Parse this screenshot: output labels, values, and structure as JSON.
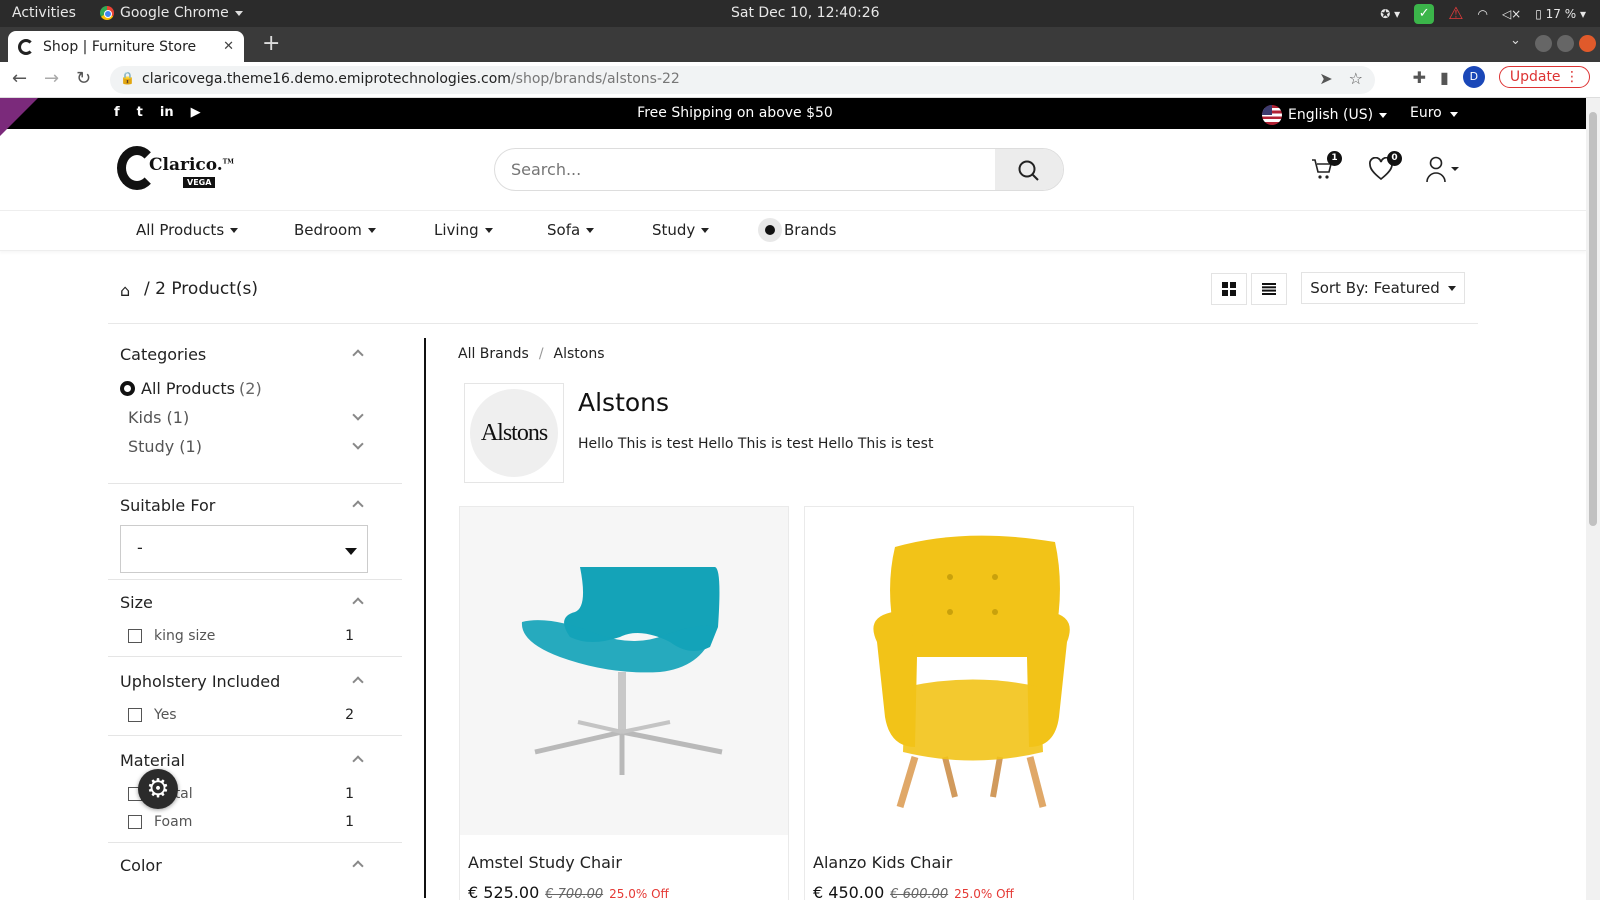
{
  "os_bar": {
    "activities": "Activities",
    "app_name": "Google Chrome",
    "clock": "Sat Dec 10, 12:40:26",
    "battery": "17 %"
  },
  "browser": {
    "tab_title": "Shop | Furniture Store",
    "url_host": "claricovega.theme16.demo.emiprotechnologies.com",
    "url_path": "/shop/brands/alstons-22",
    "profile_initial": "D",
    "update_label": "Update"
  },
  "announcement": {
    "text": "Free Shipping on above $50",
    "language": "English (US)",
    "currency": "Euro",
    "socials": [
      "facebook-icon",
      "twitter-icon",
      "linkedin-icon",
      "youtube-icon"
    ]
  },
  "header": {
    "logo_word": "Clarico.",
    "logo_tm": "TM",
    "logo_sub": "VEGA",
    "search_placeholder": "Search...",
    "cart_count": "1",
    "wishlist_count": "0"
  },
  "menu": {
    "items": [
      "All Products",
      "Bedroom",
      "Living",
      "Sofa",
      "Study"
    ],
    "brands": "Brands"
  },
  "toolbar": {
    "product_count": "/ 2 Product(s)",
    "sort_label": "Sort By: Featured"
  },
  "filters": {
    "categories": {
      "title": "Categories",
      "all": "All Products",
      "all_count": "(2)",
      "sub": [
        {
          "label": "Kids (1)"
        },
        {
          "label": "Study (1)"
        }
      ]
    },
    "suitable_for": {
      "title": "Suitable For",
      "selected": "-"
    },
    "size": {
      "title": "Size",
      "options": [
        {
          "label": "king size",
          "count": "1"
        }
      ]
    },
    "upholstery": {
      "title": "Upholstery Included",
      "options": [
        {
          "label": "Yes",
          "count": "2"
        }
      ]
    },
    "material": {
      "title": "Material",
      "options": [
        {
          "label": "Metal",
          "count": "1"
        },
        {
          "label": "Foam",
          "count": "1"
        }
      ]
    },
    "color": {
      "title": "Color"
    }
  },
  "main": {
    "crumb_all": "All Brands",
    "crumb_sep": "/",
    "crumb_current": "Alstons",
    "brand_logo_text": "Alstons",
    "brand_name": "Alstons",
    "brand_desc": "Hello This is test Hello This is test Hello This is test",
    "products": [
      {
        "name": "Amstel Study Chair",
        "price": "€ 525.00",
        "old_price": "€ 700.00",
        "discount": "25.0% Off",
        "color": "#14a3b8"
      },
      {
        "name": "Alanzo Kids Chair",
        "price": "€ 450.00",
        "old_price": "€ 600.00",
        "discount": "25.0% Off",
        "color": "#f2c318"
      }
    ]
  }
}
